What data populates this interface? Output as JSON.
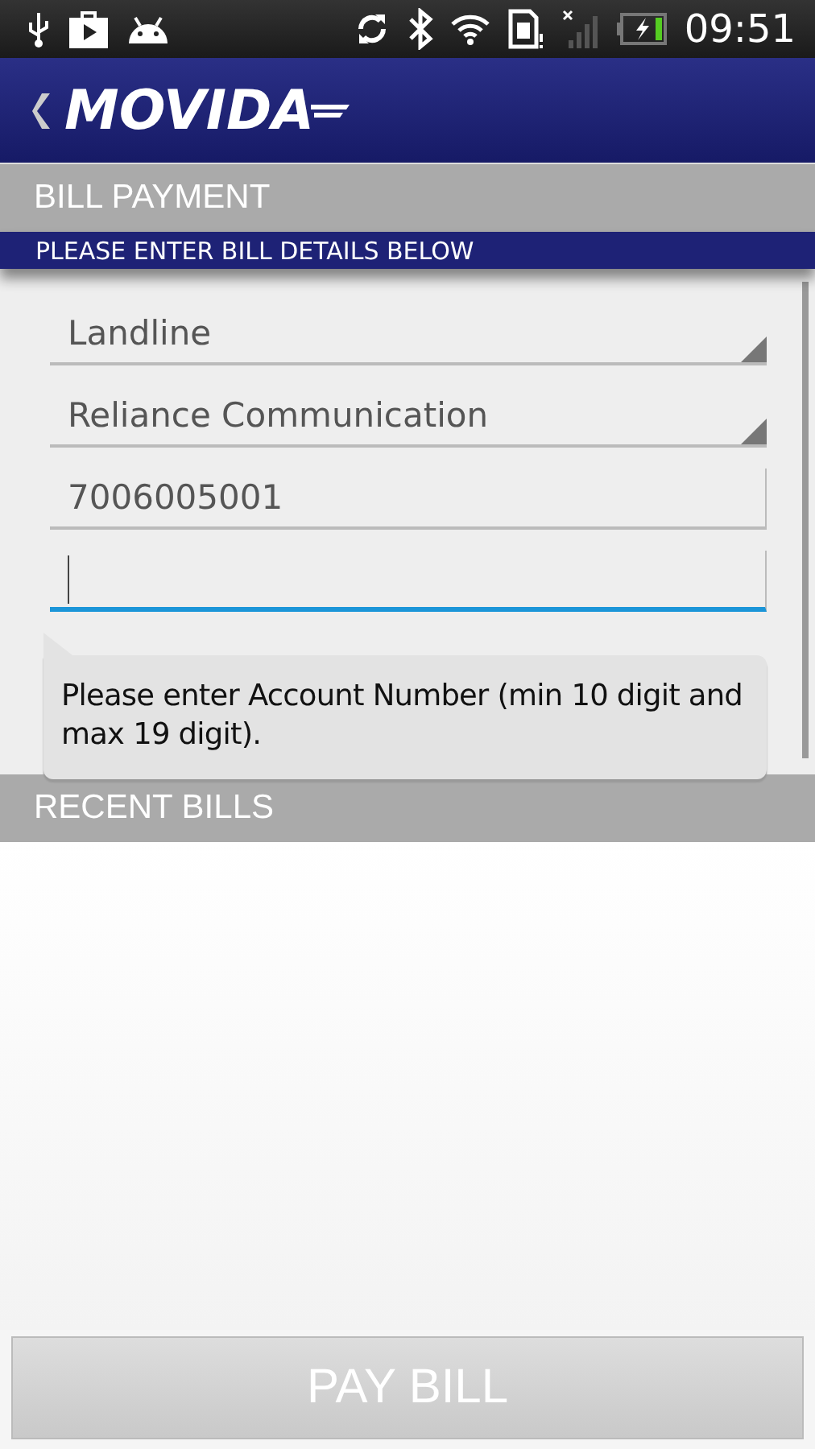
{
  "status_bar": {
    "time": "09:51"
  },
  "header": {
    "logo": "MOVIDA"
  },
  "section_title": "BILL PAYMENT",
  "instruction": "PLEASE ENTER BILL DETAILS BELOW",
  "fields": [
    {
      "kind": "dropdown",
      "value": "Landline"
    },
    {
      "kind": "dropdown",
      "value": "Reliance Communication"
    },
    {
      "kind": "text",
      "value": "7006005001",
      "focused": false
    },
    {
      "kind": "text",
      "focused": true
    }
  ],
  "error_tooltip": "Please enter Account Number (min 10 digit and max 19 digit).",
  "recent_title": "RECENT BILLS",
  "pay_button": "PAY BILL"
}
